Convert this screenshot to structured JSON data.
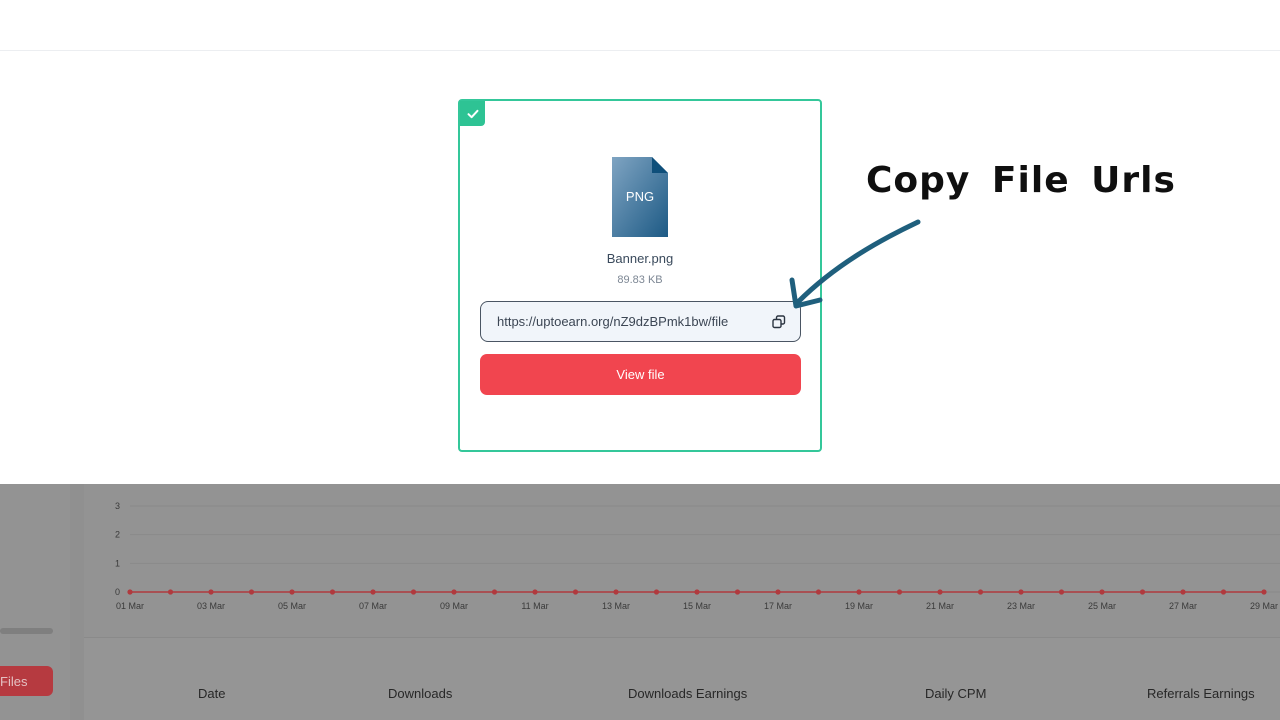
{
  "file_card": {
    "file_type": "PNG",
    "file_name": "Banner.png",
    "file_size": "89.83 KB",
    "file_url": "https://uptoearn.org/nZ9dzBPmk1bw/file",
    "view_label": "View file",
    "colors": {
      "border": "#34c79a",
      "button": "#f1454f"
    }
  },
  "annotation": {
    "text": "Copy  File Urls"
  },
  "background": {
    "sidebar_button_label": "Files",
    "table_headers": [
      "Date",
      "Downloads",
      "Downloads Earnings",
      "Daily CPM",
      "Referrals Earnings"
    ]
  },
  "chart_data": {
    "type": "line",
    "x": [
      "01 Mar",
      "02 Mar",
      "03 Mar",
      "04 Mar",
      "05 Mar",
      "06 Mar",
      "07 Mar",
      "08 Mar",
      "09 Mar",
      "10 Mar",
      "11 Mar",
      "12 Mar",
      "13 Mar",
      "14 Mar",
      "15 Mar",
      "16 Mar",
      "17 Mar",
      "18 Mar",
      "19 Mar",
      "20 Mar",
      "21 Mar",
      "22 Mar",
      "23 Mar",
      "24 Mar",
      "25 Mar",
      "26 Mar",
      "27 Mar",
      "28 Mar",
      "29 Mar"
    ],
    "x_tick_labels": [
      "01 Mar",
      "03 Mar",
      "05 Mar",
      "07 Mar",
      "09 Mar",
      "11 Mar",
      "13 Mar",
      "15 Mar",
      "17 Mar",
      "19 Mar",
      "21 Mar",
      "23 Mar",
      "25 Mar",
      "27 Mar",
      "29 Mar"
    ],
    "values": [
      0,
      0,
      0,
      0,
      0,
      0,
      0,
      0,
      0,
      0,
      0,
      0,
      0,
      0,
      0,
      0,
      0,
      0,
      0,
      0,
      0,
      0,
      0,
      0,
      0,
      0,
      0,
      0,
      0
    ],
    "y_ticks": [
      0,
      1,
      2,
      3
    ],
    "ylim": [
      0,
      3
    ],
    "grid": true,
    "line_color": "#b03a3e"
  }
}
